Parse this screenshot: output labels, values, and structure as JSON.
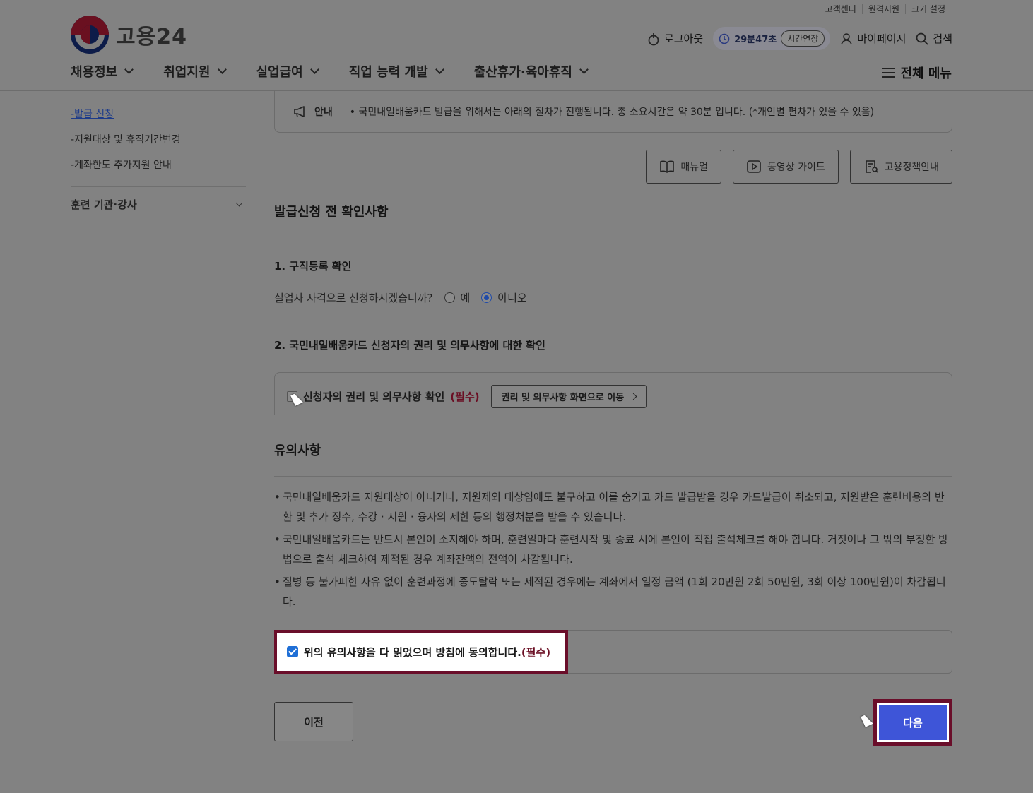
{
  "header": {
    "util_links": [
      "고객센터",
      "원격지원",
      "크기 설정"
    ],
    "logo_text": "고용24",
    "logout": "로그아웃",
    "timer": "29분47초",
    "extend": "시간연장",
    "mypage": "마이페이지",
    "search": "검색",
    "nav": [
      "채용정보",
      "취업지원",
      "실업급여",
      "직업 능력 개발",
      "출산휴가·육아휴직"
    ],
    "all_menu": "전체 메뉴"
  },
  "sidebar": {
    "subitems": [
      "발급 신청",
      "지원대상 및 휴직기간변경",
      "계좌한도 추가지원 안내"
    ],
    "group": "훈련 기관·강사"
  },
  "notice": {
    "label": "안내",
    "text": "국민내일배움카드 발급을 위해서는 아래의 절차가 진행됩니다. 총 소요시간은 약 30분 입니다. (*개인별 편차가 있을 수 있음)"
  },
  "actions": [
    "매뉴얼",
    "동영상 가이드",
    "고용정책안내"
  ],
  "section_title": "발급신청 전 확인사항",
  "step1": {
    "title": "1. 구직등록 확인",
    "question": "실업자 자격으로 신청하시겠습니까?",
    "options": [
      "예",
      "아니오"
    ],
    "selected": "아니오"
  },
  "step2": {
    "title": "2. 국민내일배움카드 신청자의 권리 및 의무사항에 대한 확인",
    "checkbox_label": "신청자의 권리 및 의무사항 확인",
    "required": "(필수)",
    "go_button": "권리 및 의무사항 화면으로 이동"
  },
  "notes": {
    "title": "유의사항",
    "items": [
      "국민내일배움카드 지원대상이 아니거나, 지원제외 대상임에도 불구하고 이를 숨기고 카드 발급받을 경우 카드발급이 취소되고, 지원받은 훈련비용의 반환 및 추가 징수, 수강 · 지원 · 융자의 제한 등의 행정처분을 받을 수 있습니다.",
      "국민내일배움카드는 반드시 본인이 소지해야 하며, 훈련일마다 훈련시작 및 종료 시에 본인이 직접 출석체크를 해야 합니다. 거짓이나 그 밖의 부정한 방법으로 출석 체크하여 제적된 경우 계좌잔액의 전액이 차감됩니다.",
      "질병 등 불가피한 사유 없이 훈련과정에 중도탈락 또는 제적된 경우에는 계좌에서 일정 금액 (1회 20만원 2회 50만원, 3회 이상 100만원)이 차감됩니다."
    ]
  },
  "agree": {
    "label": "위의 유의사항을 다 읽었으며 방침에 동의합니다.",
    "required": "(필수)",
    "checked": true
  },
  "footer_buttons": {
    "prev": "이전",
    "next": "다음"
  },
  "colors": {
    "primary": "#3e55d8",
    "highlight": "#6a0e2a",
    "required": "#6b0f24"
  }
}
